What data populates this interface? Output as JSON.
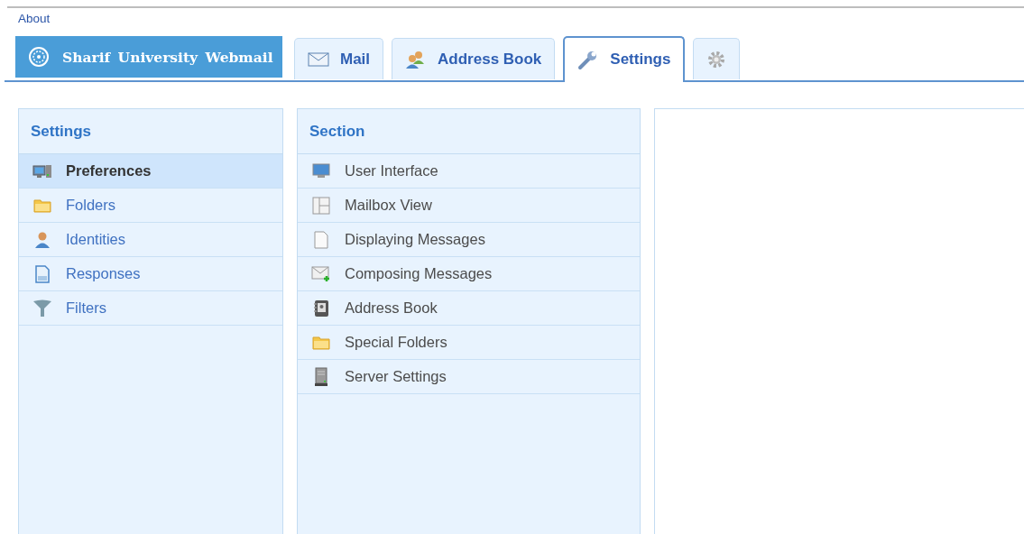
{
  "top_link": "About",
  "logo": {
    "title": "Sharif University Webmail"
  },
  "tabs": [
    {
      "label": "Mail",
      "selected": false
    },
    {
      "label": "Address Book",
      "selected": false
    },
    {
      "label": "Settings",
      "selected": true
    },
    {
      "selected": false
    }
  ],
  "settings_list": {
    "title": "Settings",
    "items": [
      {
        "label": "Preferences",
        "selected": true
      },
      {
        "label": "Folders",
        "selected": false
      },
      {
        "label": "Identities",
        "selected": false
      },
      {
        "label": "Responses",
        "selected": false
      },
      {
        "label": "Filters",
        "selected": false
      }
    ]
  },
  "section_list": {
    "title": "Section",
    "items": [
      {
        "label": "User Interface"
      },
      {
        "label": "Mailbox View"
      },
      {
        "label": "Displaying Messages"
      },
      {
        "label": "Composing Messages"
      },
      {
        "label": "Address Book"
      },
      {
        "label": "Special Folders"
      },
      {
        "label": "Server Settings"
      }
    ]
  }
}
